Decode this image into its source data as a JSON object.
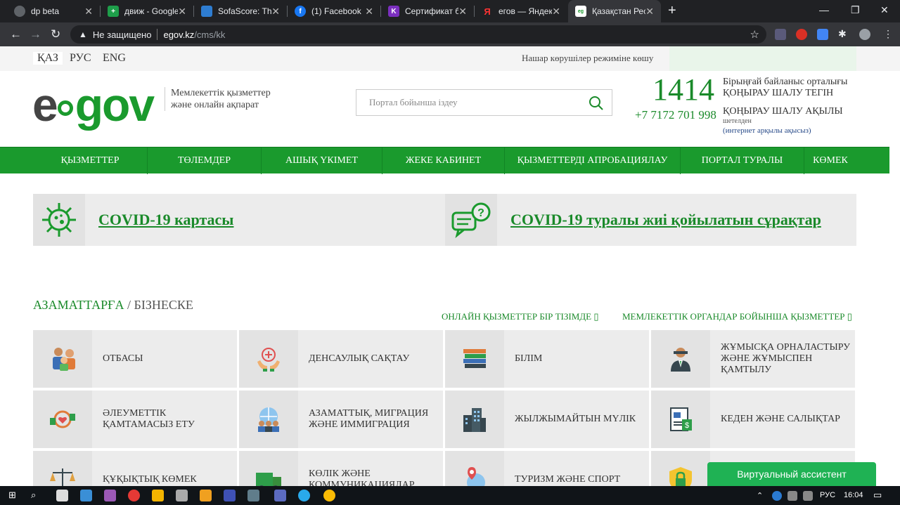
{
  "browser": {
    "tabs": [
      {
        "title": "dp beta",
        "color": "#888888",
        "glyph": ""
      },
      {
        "title": "движ - Google",
        "color": "#1e9e4a",
        "glyph": "+"
      },
      {
        "title": "SofaScore: The",
        "color": "#2e7dd1",
        "glyph": ""
      },
      {
        "title": "(1) Facebook",
        "color": "#1877f2",
        "glyph": "f"
      },
      {
        "title": "Сертификат б",
        "color": "#7b2fbf",
        "glyph": "K"
      },
      {
        "title": "егов — Яндек",
        "color": "#202124",
        "glyph": "Я"
      },
      {
        "title": "Қазақстан Рес",
        "color": "#ffffff",
        "glyph": ""
      }
    ],
    "address": {
      "security": "Не защищено",
      "host": "egov.kz",
      "path": "/cms/kk"
    }
  },
  "topbar": {
    "languages": [
      "ҚАЗ",
      "РУС",
      "ENG"
    ],
    "low_vision": "Нашар көрушілер режиміне көшу"
  },
  "header": {
    "logo_e": "e",
    "logo_gov": "gov",
    "tagline": "Мемлекеттік қызметтер және онлайн ақпарат",
    "search_placeholder": "Портал бойынша іздеу",
    "hotline_number": "1414",
    "hotline_label_1": "Бірыңғай байланыс орталығы",
    "hotline_label_2": "ҚОҢЫРАУ ШАЛУ ТЕГІН",
    "phone": "+7 7172 701 998",
    "phone_label_1": "ҚОҢЫРАУ ШАЛУ АҚЫЛЫ",
    "phone_label_2": "шетелден",
    "phone_label_3": "(интернет арқылы ақысыз)"
  },
  "nav": {
    "items": [
      "ҚЫЗМЕТТЕР",
      "ТӨЛЕМДЕР",
      "АШЫҚ ҮКІМЕТ",
      "ЖЕКЕ КАБИНЕТ",
      "ҚЫЗМЕТТЕРДІ АПРОБАЦИЯЛАУ",
      "ПОРТАЛ ТУРАЛЫ",
      "КӨМЕК"
    ]
  },
  "covid": {
    "map_link": "COVID-19 картасы",
    "faq_link": "COVID-19 туралы жиі қойылатын сұрақтар"
  },
  "section": {
    "citizens": "АЗАМАТТАРҒА",
    "slash": " / ",
    "business": "БІЗНЕСКЕ",
    "link_list": "ОНЛАЙН ҚЫЗМЕТТЕР БІР ТІЗІМДЕ ▯",
    "link_orgs": "МЕМЛЕКЕТТІК ОРГАНДАР БОЙЫНША ҚЫЗМЕТТЕР ▯"
  },
  "categories": [
    {
      "label": "ОТБАСЫ",
      "icon": "family-icon"
    },
    {
      "label": "ДЕНСАУЛЫҚ САҚТАУ",
      "icon": "health-icon"
    },
    {
      "label": "БІЛІМ",
      "icon": "books-icon"
    },
    {
      "label": "ЖҰМЫСҚА ОРНАЛАСТЫРУ ЖӘНЕ ЖҰМЫСПЕН ҚАМТЫЛУ",
      "icon": "worker-icon"
    },
    {
      "label": "ӘЛЕУМЕТТІК ҚАМТАМАСЫЗ ЕТУ",
      "icon": "social-care-icon"
    },
    {
      "label": "АЗАМАТТЫҚ, МИГРАЦИЯ ЖӘНЕ ИММИГРАЦИЯ",
      "icon": "globe-people-icon"
    },
    {
      "label": "ЖЫЛЖЫМАЙТЫН МҮЛІК",
      "icon": "buildings-icon"
    },
    {
      "label": "КЕДЕН ЖӘНЕ САЛЫҚТАР",
      "icon": "tax-document-icon"
    },
    {
      "label": "ҚҰҚЫҚТЫҚ КӨМЕК",
      "icon": "scales-icon"
    },
    {
      "label": "КӨЛІК ЖӘНЕ КОММУНИКАЦИЯЛАР",
      "icon": "truck-icon"
    },
    {
      "label": "ТУРИЗМ ЖӘНЕ СПОРТ",
      "icon": "travel-pin-icon"
    },
    {
      "label": "",
      "icon": "lock-shield-icon"
    }
  ],
  "assistant_label": "Виртуальный ассистент",
  "taskbar": {
    "lang": "РУС",
    "time": "16:04"
  }
}
